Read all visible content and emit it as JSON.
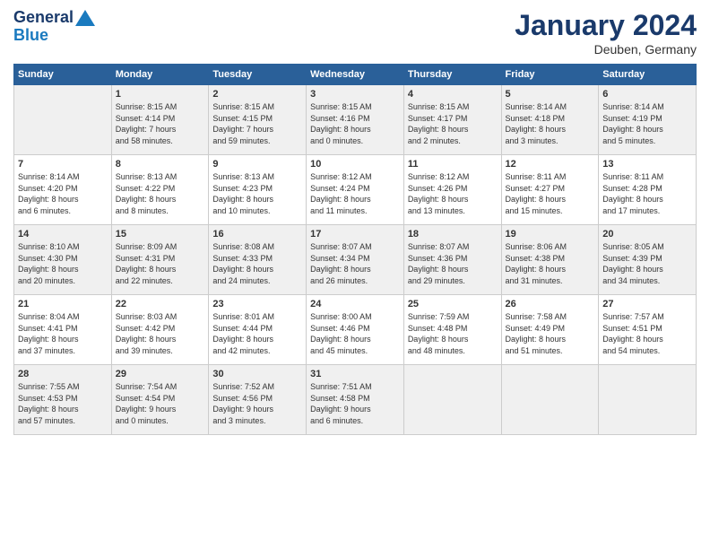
{
  "header": {
    "logo_line1": "General",
    "logo_line2": "Blue",
    "month_title": "January 2024",
    "location": "Deuben, Germany"
  },
  "weekdays": [
    "Sunday",
    "Monday",
    "Tuesday",
    "Wednesday",
    "Thursday",
    "Friday",
    "Saturday"
  ],
  "weeks": [
    [
      {
        "day": "",
        "info": ""
      },
      {
        "day": "1",
        "info": "Sunrise: 8:15 AM\nSunset: 4:14 PM\nDaylight: 7 hours\nand 58 minutes."
      },
      {
        "day": "2",
        "info": "Sunrise: 8:15 AM\nSunset: 4:15 PM\nDaylight: 7 hours\nand 59 minutes."
      },
      {
        "day": "3",
        "info": "Sunrise: 8:15 AM\nSunset: 4:16 PM\nDaylight: 8 hours\nand 0 minutes."
      },
      {
        "day": "4",
        "info": "Sunrise: 8:15 AM\nSunset: 4:17 PM\nDaylight: 8 hours\nand 2 minutes."
      },
      {
        "day": "5",
        "info": "Sunrise: 8:14 AM\nSunset: 4:18 PM\nDaylight: 8 hours\nand 3 minutes."
      },
      {
        "day": "6",
        "info": "Sunrise: 8:14 AM\nSunset: 4:19 PM\nDaylight: 8 hours\nand 5 minutes."
      }
    ],
    [
      {
        "day": "7",
        "info": "Sunrise: 8:14 AM\nSunset: 4:20 PM\nDaylight: 8 hours\nand 6 minutes."
      },
      {
        "day": "8",
        "info": "Sunrise: 8:13 AM\nSunset: 4:22 PM\nDaylight: 8 hours\nand 8 minutes."
      },
      {
        "day": "9",
        "info": "Sunrise: 8:13 AM\nSunset: 4:23 PM\nDaylight: 8 hours\nand 10 minutes."
      },
      {
        "day": "10",
        "info": "Sunrise: 8:12 AM\nSunset: 4:24 PM\nDaylight: 8 hours\nand 11 minutes."
      },
      {
        "day": "11",
        "info": "Sunrise: 8:12 AM\nSunset: 4:26 PM\nDaylight: 8 hours\nand 13 minutes."
      },
      {
        "day": "12",
        "info": "Sunrise: 8:11 AM\nSunset: 4:27 PM\nDaylight: 8 hours\nand 15 minutes."
      },
      {
        "day": "13",
        "info": "Sunrise: 8:11 AM\nSunset: 4:28 PM\nDaylight: 8 hours\nand 17 minutes."
      }
    ],
    [
      {
        "day": "14",
        "info": "Sunrise: 8:10 AM\nSunset: 4:30 PM\nDaylight: 8 hours\nand 20 minutes."
      },
      {
        "day": "15",
        "info": "Sunrise: 8:09 AM\nSunset: 4:31 PM\nDaylight: 8 hours\nand 22 minutes."
      },
      {
        "day": "16",
        "info": "Sunrise: 8:08 AM\nSunset: 4:33 PM\nDaylight: 8 hours\nand 24 minutes."
      },
      {
        "day": "17",
        "info": "Sunrise: 8:07 AM\nSunset: 4:34 PM\nDaylight: 8 hours\nand 26 minutes."
      },
      {
        "day": "18",
        "info": "Sunrise: 8:07 AM\nSunset: 4:36 PM\nDaylight: 8 hours\nand 29 minutes."
      },
      {
        "day": "19",
        "info": "Sunrise: 8:06 AM\nSunset: 4:38 PM\nDaylight: 8 hours\nand 31 minutes."
      },
      {
        "day": "20",
        "info": "Sunrise: 8:05 AM\nSunset: 4:39 PM\nDaylight: 8 hours\nand 34 minutes."
      }
    ],
    [
      {
        "day": "21",
        "info": "Sunrise: 8:04 AM\nSunset: 4:41 PM\nDaylight: 8 hours\nand 37 minutes."
      },
      {
        "day": "22",
        "info": "Sunrise: 8:03 AM\nSunset: 4:42 PM\nDaylight: 8 hours\nand 39 minutes."
      },
      {
        "day": "23",
        "info": "Sunrise: 8:01 AM\nSunset: 4:44 PM\nDaylight: 8 hours\nand 42 minutes."
      },
      {
        "day": "24",
        "info": "Sunrise: 8:00 AM\nSunset: 4:46 PM\nDaylight: 8 hours\nand 45 minutes."
      },
      {
        "day": "25",
        "info": "Sunrise: 7:59 AM\nSunset: 4:48 PM\nDaylight: 8 hours\nand 48 minutes."
      },
      {
        "day": "26",
        "info": "Sunrise: 7:58 AM\nSunset: 4:49 PM\nDaylight: 8 hours\nand 51 minutes."
      },
      {
        "day": "27",
        "info": "Sunrise: 7:57 AM\nSunset: 4:51 PM\nDaylight: 8 hours\nand 54 minutes."
      }
    ],
    [
      {
        "day": "28",
        "info": "Sunrise: 7:55 AM\nSunset: 4:53 PM\nDaylight: 8 hours\nand 57 minutes."
      },
      {
        "day": "29",
        "info": "Sunrise: 7:54 AM\nSunset: 4:54 PM\nDaylight: 9 hours\nand 0 minutes."
      },
      {
        "day": "30",
        "info": "Sunrise: 7:52 AM\nSunset: 4:56 PM\nDaylight: 9 hours\nand 3 minutes."
      },
      {
        "day": "31",
        "info": "Sunrise: 7:51 AM\nSunset: 4:58 PM\nDaylight: 9 hours\nand 6 minutes."
      },
      {
        "day": "",
        "info": ""
      },
      {
        "day": "",
        "info": ""
      },
      {
        "day": "",
        "info": ""
      }
    ]
  ]
}
